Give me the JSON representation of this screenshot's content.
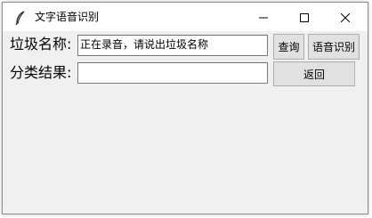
{
  "window": {
    "title": "文字语音识别",
    "controls": {
      "minimize": "minimize",
      "maximize": "maximize",
      "close": "close"
    }
  },
  "form": {
    "garbage_name_label": "垃圾名称:",
    "garbage_name_value": "正在录音，请说出垃圾名称",
    "result_label": "分类结果:",
    "result_value": ""
  },
  "buttons": {
    "query": "查询",
    "speech_recognition": "语音识别",
    "back": "返回"
  },
  "colors": {
    "window_bg": "#f0f0f0",
    "titlebar_bg": "#ffffff",
    "button_bg": "#e1e1e1",
    "button_border": "#adadad"
  },
  "icons": {
    "app": "feather-icon",
    "minimize": "minimize-icon",
    "maximize": "maximize-icon",
    "close": "close-icon"
  }
}
